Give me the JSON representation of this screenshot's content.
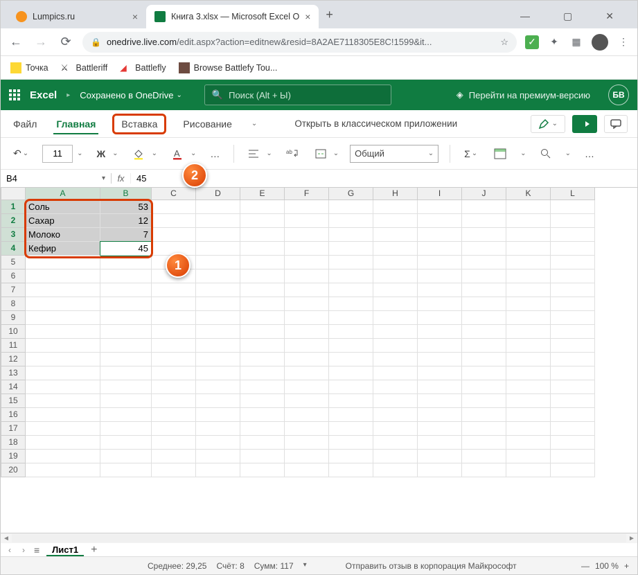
{
  "window_controls": {
    "min": "—",
    "max": "▢",
    "close": "✕"
  },
  "browser": {
    "tabs": [
      {
        "title": "Lumpics.ru",
        "fav_color": "#f7931e"
      },
      {
        "title": "Книга 3.xlsx — Microsoft Excel O",
        "fav_color": "#107c41"
      }
    ],
    "url_display": "onedrive.live.com/edit.aspx?action=editnew&resid=8A2AE7118305E8C!1599&it...",
    "url_host": "onedrive.live.com",
    "url_path": "/edit.aspx?action=editnew&resid=8A2AE7118305E8C!1599&it...",
    "bookmarks": [
      {
        "label": "Точка",
        "color": "#fdd835"
      },
      {
        "label": "Battleriff",
        "color": "#444"
      },
      {
        "label": "Battlefly",
        "color": "#e53935"
      },
      {
        "label": "Browse Battlefy Tou...",
        "color": "#6d4c41"
      }
    ]
  },
  "excel": {
    "app_name": "Excel",
    "saved_text": "Сохранено в OneDrive",
    "search_placeholder": "Поиск (Alt + Ы)",
    "premium_text": "Перейти на премиум-версию",
    "avatar_initials": "БВ"
  },
  "ribbon": {
    "tabs": {
      "file": "Файл",
      "home": "Главная",
      "insert": "Вставка",
      "draw": "Рисование"
    },
    "open_desktop": "Открыть в классическом приложении"
  },
  "toolbar": {
    "font_size": "11",
    "bold": "Ж",
    "number_format": "Общий",
    "more": "…"
  },
  "formula_bar": {
    "name_box": "B4",
    "fx": "fx",
    "value": "45"
  },
  "columns": [
    "A",
    "B",
    "C",
    "D",
    "E",
    "F",
    "G",
    "H",
    "I",
    "J",
    "K",
    "L"
  ],
  "rows": [
    1,
    2,
    3,
    4,
    5,
    6,
    7,
    8,
    9,
    10,
    11,
    12,
    13,
    14,
    15,
    16,
    17,
    18,
    19,
    20
  ],
  "cells": {
    "A1": "Соль",
    "B1": "53",
    "A2": "Сахар",
    "B2": "12",
    "A3": "Молоко",
    "B3": "7",
    "A4": "Кефир",
    "B4": "45"
  },
  "callouts": {
    "one": "1",
    "two": "2"
  },
  "sheets": {
    "active": "Лист1"
  },
  "status": {
    "avg_label": "Среднее:",
    "avg_val": "29,25",
    "count_label": "Счёт:",
    "count_val": "8",
    "sum_label": "Сумм:",
    "sum_val": "117",
    "feedback": "Отправить отзыв в корпорация Майкрософт",
    "zoom_minus": "—",
    "zoom_label": "100 %",
    "zoom_plus": "+"
  }
}
